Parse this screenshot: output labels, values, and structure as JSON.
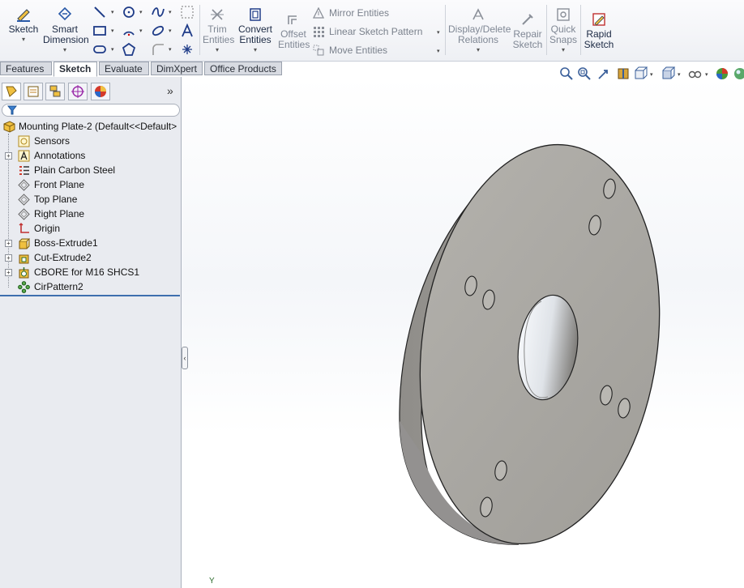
{
  "ribbon": {
    "sketch": "Sketch",
    "smart_dimension": "Smart Dimension",
    "trim_entities": "Trim Entities",
    "convert_entities": "Convert Entities",
    "offset_entities": "Offset Entities",
    "mirror_entities": "Mirror Entities",
    "linear_sketch_pattern": "Linear Sketch Pattern",
    "move_entities": "Move Entities",
    "display_delete_relations": "Display/Delete Relations",
    "repair_sketch": "Repair Sketch",
    "quick_snaps": "Quick Snaps",
    "rapid_sketch": "Rapid Sketch"
  },
  "tabs": [
    "Features",
    "Sketch",
    "Evaluate",
    "DimXpert",
    "Office Products"
  ],
  "active_tab": "Sketch",
  "tree": {
    "root": "Mounting Plate-2  (Default<<Default>",
    "items": [
      {
        "label": "Sensors",
        "icon": "sensors-icon"
      },
      {
        "label": "Annotations",
        "icon": "annotations-icon"
      },
      {
        "label": "Plain Carbon Steel",
        "icon": "material-icon"
      },
      {
        "label": "Front Plane",
        "icon": "plane-icon"
      },
      {
        "label": "Top Plane",
        "icon": "plane-icon"
      },
      {
        "label": "Right Plane",
        "icon": "plane-icon"
      },
      {
        "label": "Origin",
        "icon": "origin-icon"
      },
      {
        "label": "Boss-Extrude1",
        "icon": "boss-extrude-icon"
      },
      {
        "label": "Cut-Extrude2",
        "icon": "cut-extrude-icon"
      },
      {
        "label": "CBORE for M16 SHCS1",
        "icon": "hole-wizard-icon"
      },
      {
        "label": "CirPattern2",
        "icon": "circular-pattern-icon"
      }
    ]
  },
  "panel_more": "»",
  "triad_label": "Y",
  "colors": {
    "ribbon_text": "#1c2a44",
    "disabled_text": "#7f8794",
    "part_face": "#a9a7a2",
    "part_side": "#8f8d89",
    "tree_bg": "#e9ebf0"
  }
}
